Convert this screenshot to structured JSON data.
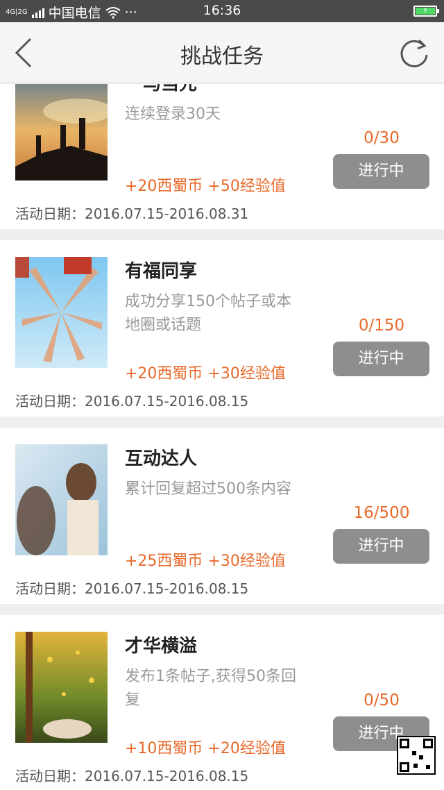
{
  "status_bar": {
    "network": "4G|2G",
    "carrier": "中国电信",
    "more": "···",
    "time": "16:36"
  },
  "nav": {
    "title": "挑战任务",
    "back_icon": "chevron-left-icon",
    "refresh_icon": "refresh-icon"
  },
  "tasks": [
    {
      "name": "一马当先",
      "description": "连续登录30天",
      "reward": "+20西蜀币 +50经验值",
      "progress": "0/30",
      "status": "进行中",
      "date": "活动日期：2016.07.15-2016.08.31"
    },
    {
      "name": "有福同享",
      "description": "成功分享150个帖子或本地圈或话题",
      "reward": "+20西蜀币 +30经验值",
      "progress": "0/150",
      "status": "进行中",
      "date": "活动日期：2016.07.15-2016.08.15"
    },
    {
      "name": "互动达人",
      "description": "累计回复超过500条内容",
      "reward": "+25西蜀币 +30经验值",
      "progress": "16/500",
      "status": "进行中",
      "date": "活动日期：2016.07.15-2016.08.15"
    },
    {
      "name": "才华横溢",
      "description": "发布1条帖子,获得50条回复",
      "reward": "+10西蜀币 +20经验值",
      "progress": "0/50",
      "status": "进行中",
      "date": "活动日期：2016.07.15-2016.08.15"
    }
  ],
  "colors": {
    "accent": "#e8692a",
    "button_bg": "#8e8e8e",
    "status_bar_bg": "#4a4a4a"
  }
}
